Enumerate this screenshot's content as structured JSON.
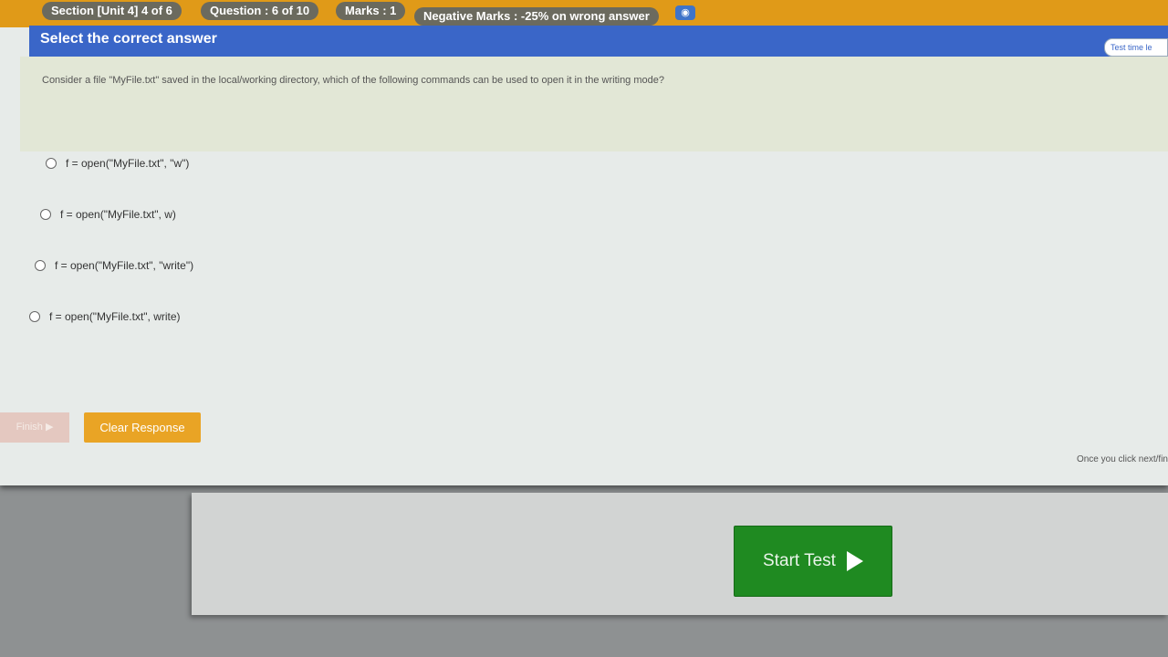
{
  "header": {
    "section": "Section [Unit 4] 4 of 6",
    "question": "Question : 6 of 10",
    "marks": "Marks : 1",
    "negative": "Negative Marks : -25% on wrong answer",
    "title": "Select the correct answer",
    "timer_badge": "Test time le"
  },
  "question": {
    "text": "Consider a file \"MyFile.txt\" saved in the local/working directory, which of the following commands can be used to open it in the writing mode?"
  },
  "options": [
    {
      "label": "f = open(\"MyFile.txt\", \"w\")"
    },
    {
      "label": "f = open(\"MyFile.txt\", w)"
    },
    {
      "label": "f = open(\"MyFile.txt\", \"write\")"
    },
    {
      "label": "f = open(\"MyFile.txt\", write)"
    }
  ],
  "buttons": {
    "finish": "Finish",
    "clear": "Clear Response",
    "start": "Start Test"
  },
  "footnote": "Once you click next/fin",
  "colors": {
    "topbar": "#e09a18",
    "bluebar": "#3a66c8",
    "start": "#1f8a21",
    "clear": "#e9a425"
  }
}
